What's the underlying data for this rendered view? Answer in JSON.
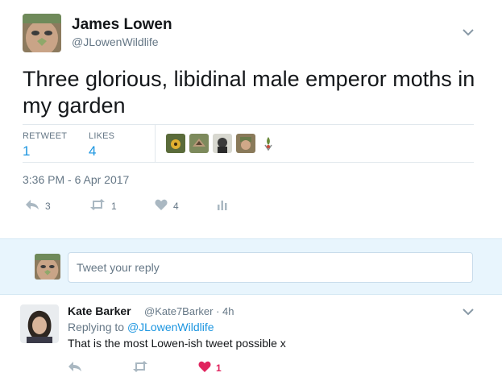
{
  "tweet": {
    "author_name": "James Lowen",
    "author_handle": "@JLowenWildlife",
    "text": "Three glorious, libidinal male emperor moths in my garden",
    "stats": {
      "retweets_label": "RETWEET",
      "retweets_value": "1",
      "likes_label": "LIKES",
      "likes_value": "4"
    },
    "timestamp": "3:36 PM - 6 Apr 2017",
    "actions": {
      "reply_count": "3",
      "retweet_count": "1",
      "like_count": "4"
    }
  },
  "reply_box": {
    "placeholder": "Tweet your reply"
  },
  "reply": {
    "author_name": "Kate Barker",
    "meta": "@Kate7Barker · 4h",
    "replying_prefix": "Replying to ",
    "replying_handle": "@JLowenWildlife",
    "text": "That is the most Lowen-ish tweet possible x",
    "actions": {
      "like_count": "1"
    }
  },
  "colors": {
    "accent": "#1b95e0",
    "muted": "#657786",
    "like_red": "#e0245e",
    "reply_bg": "#e8f5fd"
  }
}
